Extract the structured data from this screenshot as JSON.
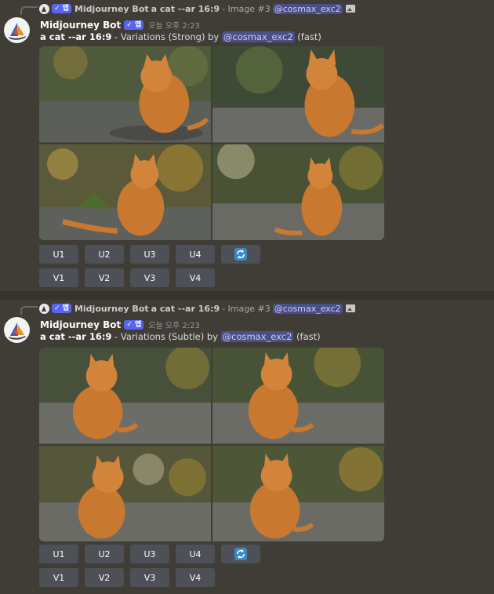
{
  "messages": [
    {
      "reply": {
        "app_badge": "✓ 앱",
        "bot_name": "Midjourney Bot",
        "prompt": "a cat --ar 16:9",
        "image_ref": "- Image #3",
        "mention": "@cosmax_exc2"
      },
      "author": "Midjourney Bot",
      "app_badge": "✓ 앱",
      "timestamp": "오늘 오후 2:23",
      "prompt": "a cat --ar 16:9",
      "variation_text": " - Variations (Strong) by ",
      "mention": "@cosmax_exc2",
      "speed": " (fast)",
      "upscale_buttons": [
        "U1",
        "U2",
        "U3",
        "U4"
      ],
      "variation_buttons": [
        "V1",
        "V2",
        "V3",
        "V4"
      ],
      "reroll_icon": "refresh-icon"
    },
    {
      "reply": {
        "app_badge": "✓ 앱",
        "bot_name": "Midjourney Bot",
        "prompt": "a cat --ar 16:9",
        "image_ref": "- Image #3",
        "mention": "@cosmax_exc2"
      },
      "author": "Midjourney Bot",
      "app_badge": "✓ 앱",
      "timestamp": "오늘 오후 2:23",
      "prompt": "a cat --ar 16:9",
      "variation_text": " - Variations (Subtle) by ",
      "mention": "@cosmax_exc2",
      "speed": " (fast)",
      "upscale_buttons": [
        "U1",
        "U2",
        "U3",
        "U4"
      ],
      "variation_buttons": [
        "V1",
        "V2",
        "V3",
        "V4"
      ],
      "reroll_icon": "refresh-icon"
    }
  ],
  "colors": {
    "background": "#403d36",
    "button": "#4e5058",
    "app_badge": "#5865f2",
    "mention_bg": "#4a4f85",
    "cat_fur": "#c9782f"
  }
}
